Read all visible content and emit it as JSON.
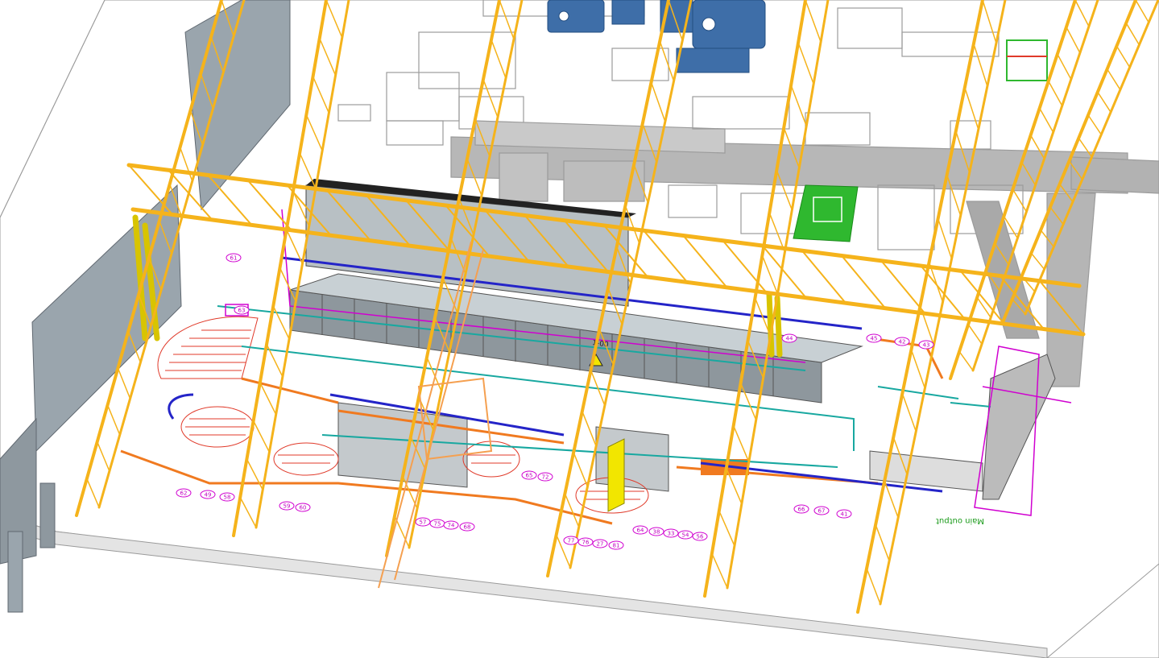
{
  "drawing": {
    "floor_color": "#f2f2f2",
    "truss_color": "#f5b31b",
    "truss_shadow": "#c98a06",
    "wall_color": "#9aa5ad",
    "cabinet_color": "#8e979d",
    "upper_layout_color": "#9b9b9b",
    "blue_equipment_color": "#3e6ea8",
    "green_block_color": "#2fb82f",
    "conveyor_orange": "#f07a20",
    "hatch_red": "#e03a2a",
    "cyan_line": "#18a8a0",
    "magenta": "#d000d0",
    "pipe_blue": "#2424c8",
    "yellow_panel": "#f2e600"
  },
  "labels": {
    "main_output": "Main output",
    "cabinet_mark": "1-00"
  },
  "balloons": [
    "61",
    "63",
    "62",
    "49",
    "58",
    "59",
    "60",
    "57",
    "75",
    "74",
    "68",
    "65",
    "72",
    "77",
    "76",
    "27",
    "81",
    "64",
    "38",
    "33",
    "54",
    "56",
    "66",
    "67",
    "41",
    "45",
    "42",
    "43",
    "44"
  ]
}
